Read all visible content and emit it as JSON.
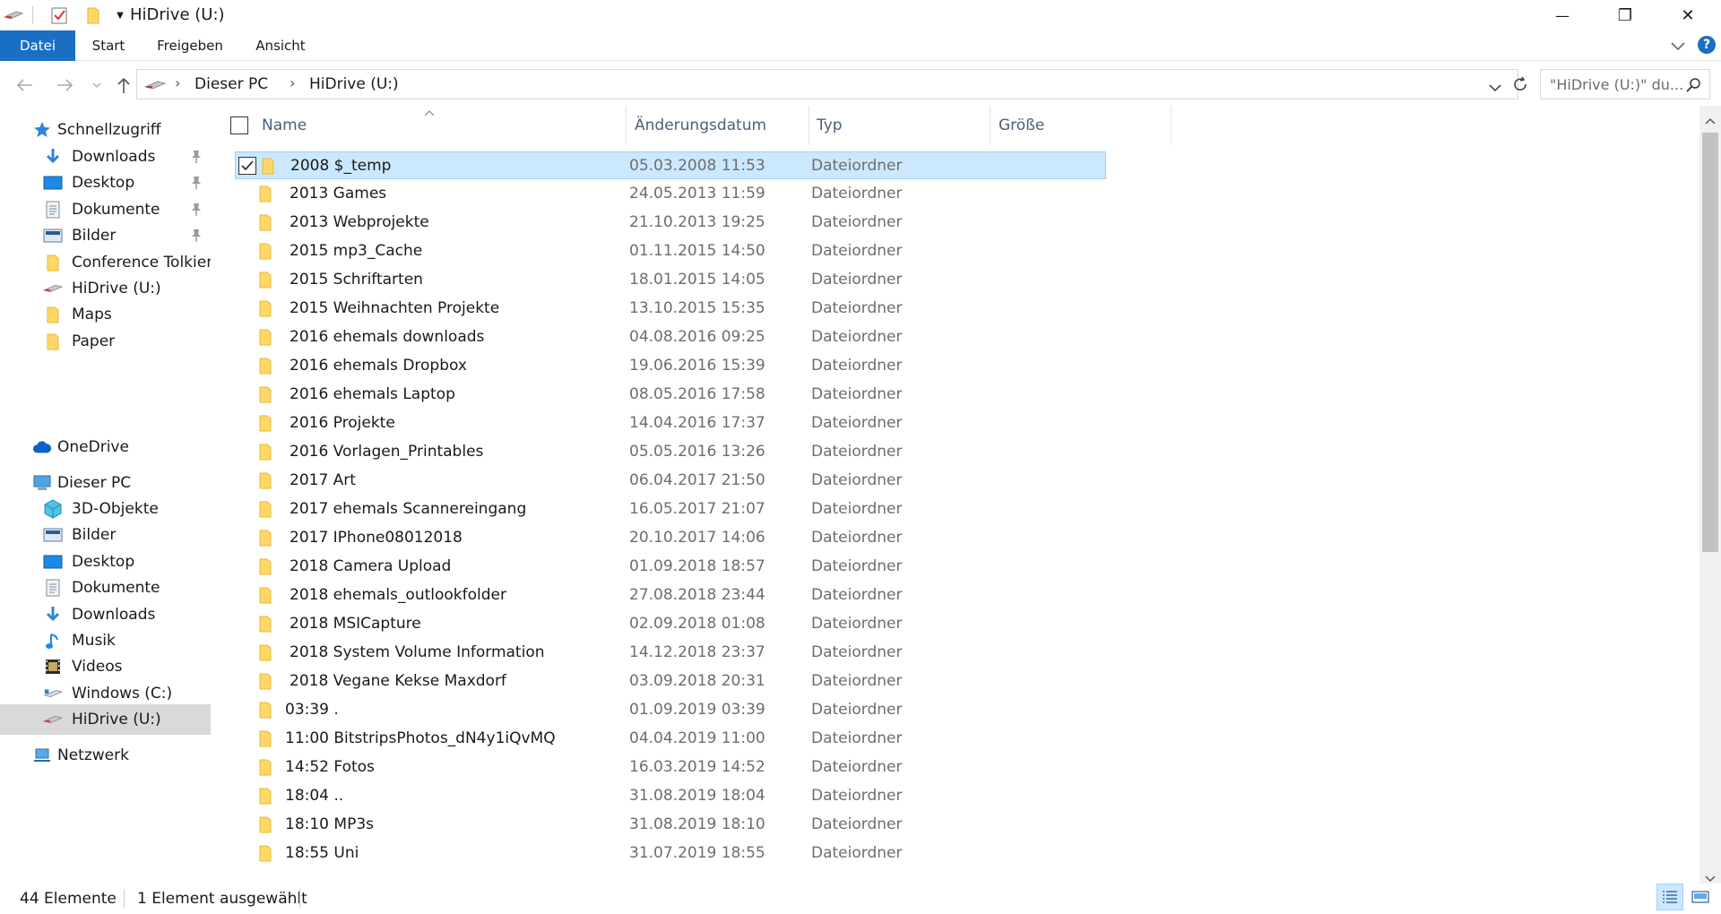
{
  "window": {
    "title": "HiDrive (U:)",
    "minimize_glyph": "—",
    "restore_glyph": "❐",
    "close_glyph": "✕"
  },
  "ribbon": {
    "tabs": [
      "Datei",
      "Start",
      "Freigeben",
      "Ansicht"
    ]
  },
  "address": {
    "crumbs": [
      "Dieser PC",
      "HiDrive (U:)"
    ],
    "search_placeholder": "\"HiDrive (U:)\" du..."
  },
  "nav": {
    "quick_access": "Schnellzugriff",
    "quick_items": [
      {
        "label": "Downloads",
        "icon": "download-arrow-icon",
        "pinned": true
      },
      {
        "label": "Desktop",
        "icon": "desktop-icon",
        "pinned": true
      },
      {
        "label": "Dokumente",
        "icon": "documents-icon",
        "pinned": true
      },
      {
        "label": "Bilder",
        "icon": "pictures-icon",
        "pinned": true
      },
      {
        "label": "Conference Tolkien S",
        "icon": "folder-icon",
        "pinned": false
      },
      {
        "label": "HiDrive (U:)",
        "icon": "network-drive-icon",
        "pinned": false
      },
      {
        "label": "Maps",
        "icon": "folder-icon",
        "pinned": false
      },
      {
        "label": "Paper",
        "icon": "folder-icon",
        "pinned": false
      }
    ],
    "onedrive": "OneDrive",
    "this_pc": "Dieser PC",
    "pc_items": [
      {
        "label": "3D-Objekte",
        "icon": "3d-objects-icon"
      },
      {
        "label": "Bilder",
        "icon": "pictures-icon"
      },
      {
        "label": "Desktop",
        "icon": "desktop-icon"
      },
      {
        "label": "Dokumente",
        "icon": "documents-icon"
      },
      {
        "label": "Downloads",
        "icon": "download-arrow-icon"
      },
      {
        "label": "Musik",
        "icon": "music-icon"
      },
      {
        "label": "Videos",
        "icon": "videos-icon"
      },
      {
        "label": "Windows (C:)",
        "icon": "local-drive-icon"
      },
      {
        "label": "HiDrive (U:)",
        "icon": "network-drive-icon",
        "selected": true
      }
    ],
    "network": "Netzwerk"
  },
  "list": {
    "columns": [
      "Name",
      "Änderungsdatum",
      "Typ",
      "Größe"
    ],
    "rows": [
      {
        "name": "2008 $_temp",
        "date": "05.03.2008 11:53",
        "type": "Dateiordner",
        "selected": true
      },
      {
        "name": "2013 Games",
        "date": "24.05.2013 11:59",
        "type": "Dateiordner"
      },
      {
        "name": "2013 Webprojekte",
        "date": "21.10.2013 19:25",
        "type": "Dateiordner"
      },
      {
        "name": "2015 mp3_Cache",
        "date": "01.11.2015 14:50",
        "type": "Dateiordner"
      },
      {
        "name": "2015 Schriftarten",
        "date": "18.01.2015 14:05",
        "type": "Dateiordner"
      },
      {
        "name": "2015 Weihnachten Projekte",
        "date": "13.10.2015 15:35",
        "type": "Dateiordner"
      },
      {
        "name": "2016 ehemals downloads",
        "date": "04.08.2016 09:25",
        "type": "Dateiordner"
      },
      {
        "name": "2016 ehemals Dropbox",
        "date": "19.06.2016 15:39",
        "type": "Dateiordner"
      },
      {
        "name": "2016 ehemals Laptop",
        "date": "08.05.2016 17:58",
        "type": "Dateiordner"
      },
      {
        "name": "2016 Projekte",
        "date": "14.04.2016 17:37",
        "type": "Dateiordner"
      },
      {
        "name": "2016 Vorlagen_Printables",
        "date": "05.05.2016 13:26",
        "type": "Dateiordner"
      },
      {
        "name": "2017 Art",
        "date": "06.04.2017 21:50",
        "type": "Dateiordner"
      },
      {
        "name": "2017 ehemals Scannereingang",
        "date": "16.05.2017 21:07",
        "type": "Dateiordner"
      },
      {
        "name": "2017 IPhone08012018",
        "date": "20.10.2017 14:06",
        "type": "Dateiordner"
      },
      {
        "name": "2018 Camera Upload",
        "date": "01.09.2018 18:57",
        "type": "Dateiordner"
      },
      {
        "name": "2018 ehemals_outlookfolder",
        "date": "27.08.2018 23:44",
        "type": "Dateiordner"
      },
      {
        "name": "2018 MSICapture",
        "date": "02.09.2018 01:08",
        "type": "Dateiordner"
      },
      {
        "name": "2018 System Volume Information",
        "date": "14.12.2018 23:37",
        "type": "Dateiordner"
      },
      {
        "name": "2018 Vegane Kekse Maxdorf",
        "date": "03.09.2018 20:31",
        "type": "Dateiordner"
      },
      {
        "name": "03:39 .",
        "date": "01.09.2019 03:39",
        "type": "Dateiordner"
      },
      {
        "name": "11:00 BitstripsPhotos_dN4y1iQvMQ",
        "date": "04.04.2019 11:00",
        "type": "Dateiordner"
      },
      {
        "name": "14:52 Fotos",
        "date": "16.03.2019 14:52",
        "type": "Dateiordner"
      },
      {
        "name": "18:04 ..",
        "date": "31.08.2019 18:04",
        "type": "Dateiordner"
      },
      {
        "name": "18:10 MP3s",
        "date": "31.08.2019 18:10",
        "type": "Dateiordner"
      },
      {
        "name": "18:55 Uni",
        "date": "31.07.2019 18:55",
        "type": "Dateiordner"
      }
    ]
  },
  "status": {
    "count": "44 Elemente",
    "selection": "1 Element ausgewählt"
  },
  "colors": {
    "accent": "#1a6fc4",
    "selection_bg": "#cce8ff",
    "selection_border": "#99d1ff",
    "folder_yellow": "#ffd766"
  }
}
